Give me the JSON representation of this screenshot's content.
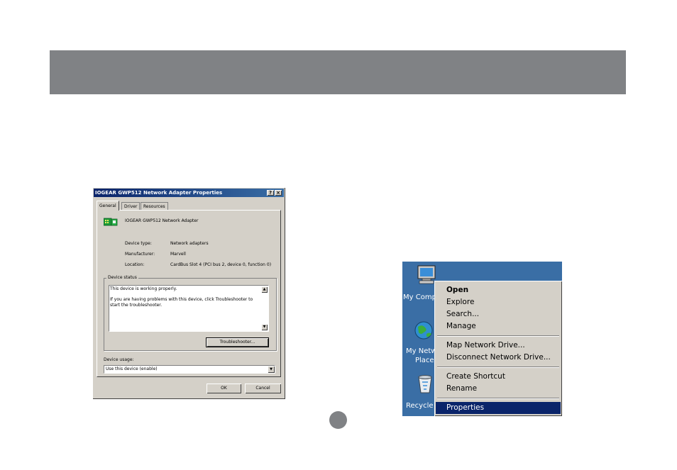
{
  "dialog": {
    "title": "IOGEAR GWP512 Network Adapter Properties",
    "help_label": "?",
    "close_label": "×",
    "tabs": [
      {
        "label": "General"
      },
      {
        "label": "Driver"
      },
      {
        "label": "Resources"
      }
    ],
    "device_name": "IOGEAR GWP512 Network Adapter",
    "device_type_label": "Device type:",
    "device_type_value": "Network adapters",
    "manufacturer_label": "Manufacturer:",
    "manufacturer_value": "Marvell",
    "location_label": "Location:",
    "location_value": "CardBus Slot 4 (PCI bus 2, device 0, function 0)",
    "status_group_label": "Device status",
    "status_line1": "This device is working properly.",
    "status_line2": "If you are having problems with this device, click Troubleshooter to",
    "status_line3": "start the troubleshooter.",
    "troubleshooter_label": "Troubleshooter...",
    "usage_label": "Device usage:",
    "usage_value": "Use this device (enable)",
    "ok_label": "OK",
    "cancel_label": "Cancel"
  },
  "desktop": {
    "icons": [
      {
        "label": "My Comp",
        "icon": "my-computer-icon"
      },
      {
        "label1": "My Netw",
        "label2": "Place",
        "icon": "network-places-icon"
      },
      {
        "label": "Recycle",
        "icon": "recycle-bin-icon"
      }
    ],
    "background_color": "#3a6ea5"
  },
  "context_menu": {
    "items": [
      {
        "label": "Open",
        "bold": true
      },
      {
        "label": "Explore"
      },
      {
        "label": "Search..."
      },
      {
        "label": "Manage"
      },
      {
        "label": "Map Network Drive..."
      },
      {
        "label": "Disconnect Network Drive..."
      },
      {
        "label": "Create Shortcut"
      },
      {
        "label": "Rename"
      },
      {
        "label": "Properties",
        "selected": true
      }
    ],
    "highlight_color": "#0a246a"
  },
  "colors": {
    "banner": "#808285",
    "dialog_face": "#d4d0c8",
    "title_bar": "#0a246a"
  }
}
